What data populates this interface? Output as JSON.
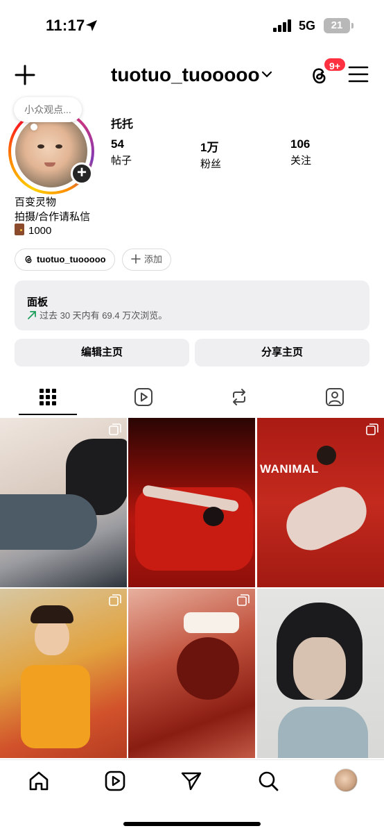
{
  "status": {
    "time": "11:17",
    "network": "5G",
    "battery": "21"
  },
  "header": {
    "username": "tuotuo_tuooooo",
    "notification_badge": "9+"
  },
  "profile": {
    "note": "小众观点...",
    "display_name": "托托",
    "stats": [
      {
        "value": "54",
        "label": "帖子"
      },
      {
        "value": "1万",
        "label": "粉丝"
      },
      {
        "value": "106",
        "label": "关注"
      }
    ],
    "bio": [
      "百变灵物",
      "拍摄/合作请私信",
      "1000"
    ],
    "threads_handle": "tuotuo_tuooooo",
    "add_label": "添加"
  },
  "panel": {
    "title": "面板",
    "subtitle": "过去 30 天内有 69.4 万次浏览。"
  },
  "buttons": {
    "edit": "编辑主页",
    "share": "分享主页"
  },
  "tabs": [
    "grid-icon",
    "reels-icon",
    "reposts-icon",
    "tagged-icon"
  ],
  "grid": {
    "overlay_text": "WANIMAL"
  },
  "colors": {
    "badge": "#ff3040",
    "panel_bg": "#efeff2",
    "trend_green": "#1b9e5a"
  }
}
